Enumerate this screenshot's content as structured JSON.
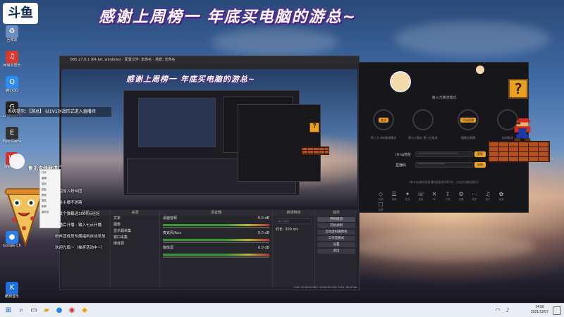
{
  "banner": {
    "text": "感谢上周榜一 年底买电脑的游总~"
  },
  "preview_banner": {
    "text": "感谢上周榜一 年底买电脑的游总~"
  },
  "logo": {
    "text": "斗鱼"
  },
  "desktop_icons": [
    {
      "name": "recycle",
      "label": "回收站",
      "color": "#6a8ec0",
      "glyph": "♻"
    },
    {
      "name": "netease",
      "label": "网易云音乐",
      "color": "#d33a31",
      "glyph": "♫"
    },
    {
      "name": "qq",
      "label": "腾讯QQ",
      "color": "#2d8cf0",
      "glyph": "Q"
    },
    {
      "name": "logitech",
      "label": "Logitech G HUB",
      "color": "#222",
      "glyph": "G"
    },
    {
      "name": "epic",
      "label": "Epic Games",
      "color": "#333",
      "glyph": "E"
    },
    {
      "name": "wegame",
      "label": "WeGame",
      "color": "#c33",
      "glyph": "W"
    },
    {
      "name": "chrome",
      "label": "Google Chrome",
      "color": "#2b7de9",
      "glyph": "●"
    },
    {
      "name": "kugou",
      "label": "酷狗音乐",
      "color": "#1e6fd9",
      "glyph": "K"
    }
  ],
  "obs": {
    "title": "OBS 27.0.1 (64-bit, windows) - 配置文件: 未命名 - 场景: 未命名",
    "docks": {
      "scenes_title": "场景",
      "sources_title": "来源",
      "mixer_title": "混音器",
      "transitions_title": "转场特效",
      "controls_title": "控件",
      "sources": [
        "文本",
        "图像",
        "显示器采集",
        "窗口采集",
        "媒体源"
      ],
      "mixer": [
        {
          "label": "桌面音频",
          "value": "0.0 dB"
        },
        {
          "label": "麦克风/Aux",
          "value": "0.0 dB"
        },
        {
          "label": "媒体源",
          "value": "0.0 dB"
        }
      ],
      "transition": "淡入淡出",
      "duration_label": "时长",
      "duration_value": "300 ms",
      "controls": [
        "开始推流",
        "开始录制",
        "启动虚拟摄像机",
        "工作室模式",
        "设置",
        "退出"
      ]
    },
    "status": "LIVE: 00:00:00  REC: 00:00:00  CPU: 3.6%, 60.00 fps"
  },
  "app": {
    "mode_heading": "第三方推流模式",
    "modes": [
      {
        "badge": "推流",
        "caption": "第三方 obs推流模式"
      },
      {
        "badge": "",
        "caption": "默认小窗口 第三方推流"
      },
      {
        "badge": "开始直播",
        "caption": "摄像头直播"
      },
      {
        "badge": "",
        "caption": "自动推流"
      }
    ],
    "fields": [
      {
        "label": "rtmp地址",
        "value": "****************************",
        "button": "复制"
      },
      {
        "label": "直播码",
        "value": "*******************",
        "button": "复制"
      }
    ],
    "note": "将rtmp地址和直播码复制到OBS中，点击开始推流即可",
    "tools": [
      "礼物",
      "弹幕",
      "任务",
      "连麦",
      "PK",
      "分享",
      "设置",
      "更多",
      "音乐",
      "抽奖",
      "投票"
    ]
  },
  "overlay": {
    "title": "鲁迅说伴我进厂",
    "notice": "系统提示：【游总】 以1V1对战形式进入直播间",
    "chat": [
      {
        "user": "",
        "text": "欢迎加入粉丝团"
      },
      {
        "user": "",
        "text": "关注主播不迷路"
      },
      {
        "user": "",
        "text": "一发个弹幕送3000点经验"
      },
      {
        "user": "",
        "text": "开播后开播 - 输入七点开播"
      },
      {
        "user": "",
        "text": "粉丝团成员专属福利自动发放"
      },
      {
        "user": "",
        "text": "欢迎光临～（抽奖活动中~）"
      }
    ],
    "menu": [
      "打开",
      "编辑",
      "复制",
      "粘贴",
      "删除",
      "属性",
      "刷新",
      "重命名"
    ]
  },
  "taskbar": {
    "time": "14:56",
    "date": "2021/12/07"
  }
}
